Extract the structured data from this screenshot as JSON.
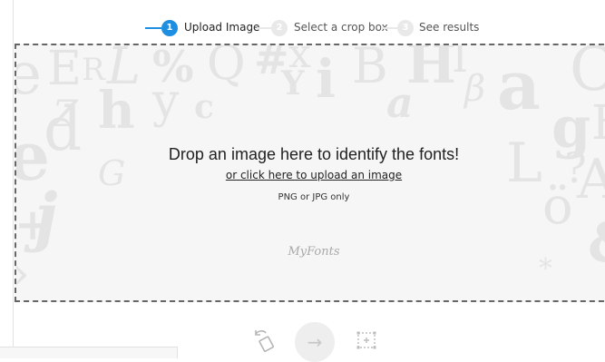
{
  "stepper": {
    "steps": [
      {
        "number": "1",
        "label": "Upload Image"
      },
      {
        "number": "2",
        "label": "Select a crop box"
      },
      {
        "number": "3",
        "label": "See results"
      }
    ]
  },
  "dropzone": {
    "title": "Drop an image here to identify the fonts!",
    "link": "or click here to upload an image",
    "note": "PNG or JPG only",
    "logo_text": "MyFonts"
  },
  "toolbar": {
    "next_icon": "→"
  },
  "colors": {
    "accent": "#1e8fe0",
    "inactive": "#e9e9e9"
  }
}
